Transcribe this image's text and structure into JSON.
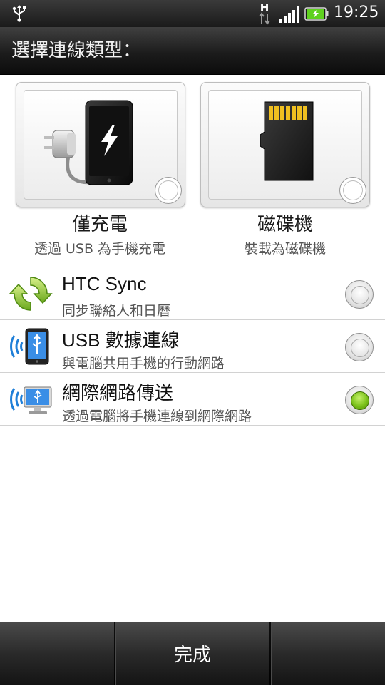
{
  "status_bar": {
    "time": "19:25",
    "network_type": "H",
    "icons": [
      "usb-icon",
      "network-h-icon",
      "signal-icon",
      "battery-icon"
    ]
  },
  "title": "選擇連線類型：",
  "tiles": [
    {
      "title": "僅充電",
      "subtitle": "透過 USB 為手機充電",
      "icon": "charge-phone-icon",
      "selected": false
    },
    {
      "title": "磁碟機",
      "subtitle": "裝載為磁碟機",
      "icon": "sd-card-icon",
      "selected": false
    }
  ],
  "options": [
    {
      "title": "HTC Sync",
      "subtitle": "同步聯絡人和日曆",
      "icon": "sync-icon",
      "selected": false
    },
    {
      "title": "USB 數據連線",
      "subtitle": "與電腦共用手機的行動網路",
      "icon": "usb-tethering-icon",
      "selected": false
    },
    {
      "title": "網際網路傳送",
      "subtitle": "透過電腦將手機連線到網際網路",
      "icon": "internet-pass-through-icon",
      "selected": true
    }
  ],
  "footer": {
    "done_label": "完成"
  },
  "colors": {
    "accent_green": "#7bc21a",
    "battery_green": "#5fd11f"
  }
}
